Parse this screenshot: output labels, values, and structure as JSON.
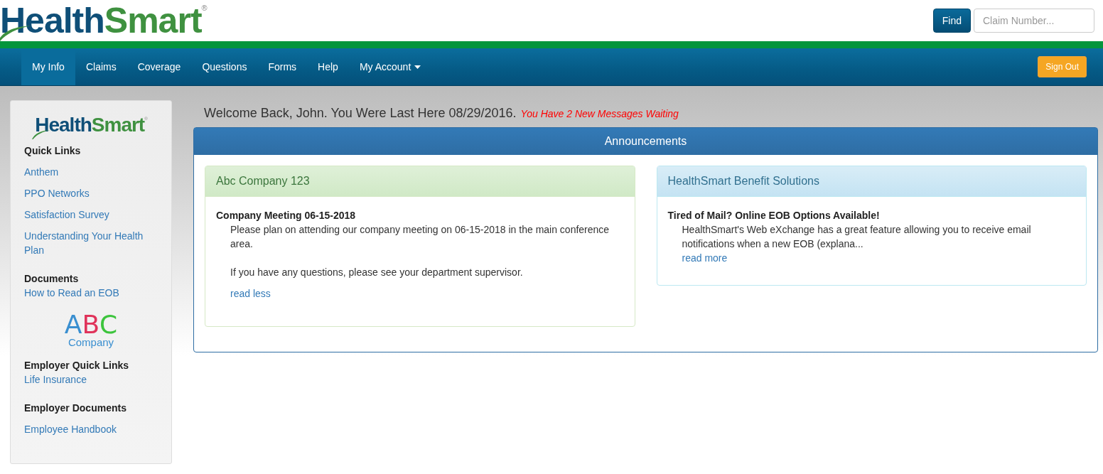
{
  "header": {
    "logo": {
      "first": "Health",
      "second": "Smart",
      "mark": "®"
    },
    "find_button": "Find",
    "claim_field": {
      "placeholder": "Claim Number..."
    }
  },
  "nav": {
    "items": [
      {
        "label": "My Info",
        "selected": true,
        "dropdown": false
      },
      {
        "label": "Claims",
        "selected": false,
        "dropdown": false
      },
      {
        "label": "Coverage",
        "selected": false,
        "dropdown": false
      },
      {
        "label": "Questions",
        "selected": false,
        "dropdown": false
      },
      {
        "label": "Forms",
        "selected": false,
        "dropdown": false
      },
      {
        "label": "Help",
        "selected": false,
        "dropdown": false
      },
      {
        "label": "My Account",
        "selected": false,
        "dropdown": true
      }
    ],
    "sign_out": "Sign Out"
  },
  "sidebar": {
    "logo": {
      "first": "Health",
      "second": "Smart",
      "mark": "®"
    },
    "sections": [
      {
        "kind": "links",
        "heading": "Quick Links",
        "spaced": true,
        "links": [
          "Anthem",
          "PPO Networks",
          "Satisfaction Survey",
          "Understanding Your Health Plan"
        ]
      },
      {
        "kind": "links",
        "heading": "Documents",
        "spaced": false,
        "links": [
          "How to Read an EOB"
        ]
      },
      {
        "kind": "company_logo",
        "letters": [
          {
            "text": "A",
            "color": "#3a8fd0"
          },
          {
            "text": "B",
            "color": "#e0335a"
          },
          {
            "text": "C",
            "color": "#3cc43c"
          }
        ],
        "caption": "Company"
      },
      {
        "kind": "links",
        "heading": "Employer Quick Links",
        "spaced": false,
        "links": [
          "Life Insurance"
        ]
      },
      {
        "kind": "links",
        "heading": "Employer Documents",
        "spaced": true,
        "links": [
          "Employee Handbook"
        ]
      }
    ]
  },
  "welcome": {
    "text": "Welcome Back, John. You Were Last Here 08/29/2016.",
    "messages": "You Have 2 New Messages Waiting"
  },
  "announcements": {
    "title": "Announcements",
    "cards": [
      {
        "kind": "success",
        "title": "Abc Company 123",
        "headline": "Company Meeting 06-15-2018",
        "paragraphs": [
          "Please plan on attending our company meeting on 06-15-2018 in the main conference area.",
          "If you have any questions, please see your department supervisor."
        ],
        "link": "read less"
      },
      {
        "kind": "info",
        "title": "HealthSmart Benefit Solutions",
        "headline": "Tired of Mail? Online EOB Options Available!",
        "paragraphs": [
          "HealthSmart's Web eXchange has a great feature allowing you to receive email notifications when a new EOB (explana..."
        ],
        "link": "read more"
      }
    ]
  }
}
